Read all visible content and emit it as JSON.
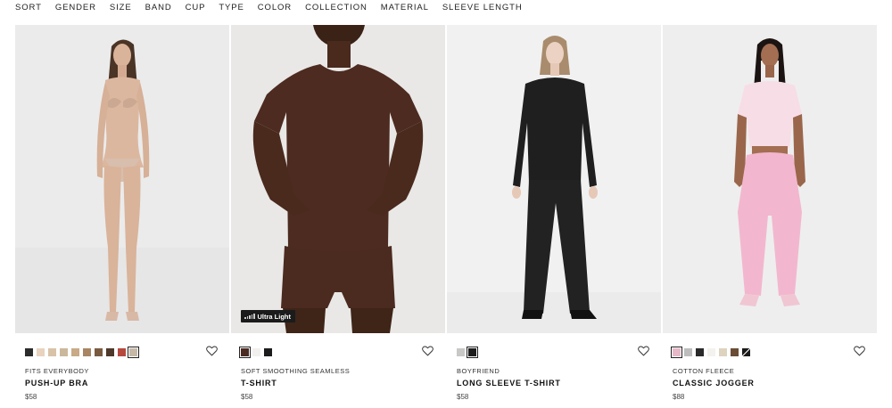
{
  "filters": [
    "SORT",
    "GENDER",
    "SIZE",
    "BAND",
    "CUP",
    "TYPE",
    "COLOR",
    "COLLECTION",
    "MATERIAL",
    "SLEEVE LENGTH"
  ],
  "products": [
    {
      "collection": "FITS EVERYBODY",
      "name": "PUSH-UP BRA",
      "price": "$58",
      "badge": "",
      "selected_swatch": 9,
      "swatches": [
        "#2b2b2b",
        "#e8d3bf",
        "#d8c2a8",
        "#cbb89c",
        "#c9a987",
        "#a88563",
        "#7a5a3f",
        "#4e3829",
        "#b5493e",
        "#c6b8a7"
      ]
    },
    {
      "collection": "SOFT SMOOTHING SEAMLESS",
      "name": "T-SHIRT",
      "price": "$58",
      "badge": "Ultra Light",
      "selected_swatch": 0,
      "swatches": [
        "#4a2a22",
        "#f2f0ee",
        "#1c1c1c"
      ]
    },
    {
      "collection": "BOYFRIEND",
      "name": "LONG SLEEVE T-SHIRT",
      "price": "$58",
      "badge": "",
      "selected_swatch": 1,
      "swatches": [
        "#c8c8c6",
        "#1d1d1d"
      ]
    },
    {
      "collection": "COTTON FLEECE",
      "name": "CLASSIC JOGGER",
      "price": "$88",
      "badge": "",
      "selected_swatch": 0,
      "swatches": [
        "#e7b8c8",
        "#bdbdbd",
        "#2a2a2a",
        "#f4f2ee",
        "#ddd3bf",
        "#6b4c35",
        "pattern"
      ]
    }
  ],
  "icons": {
    "favorite": "heart-outline-icon"
  },
  "colors": {
    "photo_bg": "#eeeeee",
    "text": "#111111",
    "badge_bg": "#1b1b1b"
  }
}
